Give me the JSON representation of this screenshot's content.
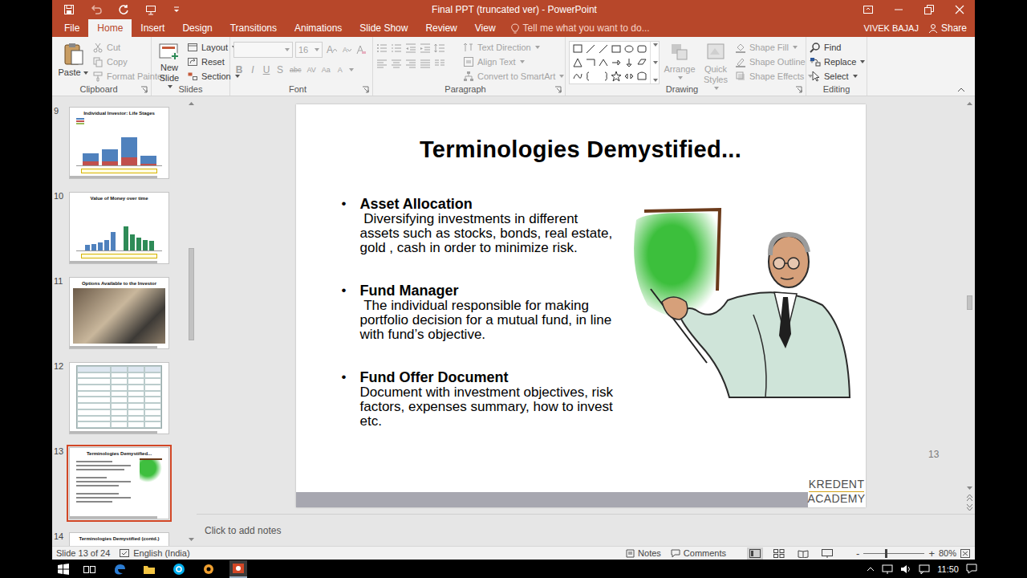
{
  "window": {
    "title": "Final PPT (truncated ver) - PowerPoint"
  },
  "tabs": [
    {
      "label": "File",
      "selected": false
    },
    {
      "label": "Home",
      "selected": true
    },
    {
      "label": "Insert",
      "selected": false
    },
    {
      "label": "Design",
      "selected": false
    },
    {
      "label": "Transitions",
      "selected": false
    },
    {
      "label": "Animations",
      "selected": false
    },
    {
      "label": "Slide Show",
      "selected": false
    },
    {
      "label": "Review",
      "selected": false
    },
    {
      "label": "View",
      "selected": false
    }
  ],
  "tell_me": "Tell me what you want to do...",
  "account": {
    "user": "VIVEK BAJAJ",
    "share": "Share"
  },
  "ribbon": {
    "clipboard": {
      "label": "Clipboard",
      "paste": "Paste",
      "items": [
        {
          "label": "Cut",
          "disabled": true
        },
        {
          "label": "Copy",
          "disabled": true
        },
        {
          "label": "Format Painter",
          "disabled": true
        }
      ]
    },
    "slides": {
      "label": "Slides",
      "new_slide": "New Slide",
      "items": [
        {
          "label": "Layout",
          "dropdown": true
        },
        {
          "label": "Reset",
          "dropdown": false
        },
        {
          "label": "Section",
          "dropdown": true
        }
      ]
    },
    "font": {
      "label": "Font",
      "size": "16",
      "disabled": true,
      "size_buttons": [
        "A",
        "A"
      ],
      "buttons": [
        "B",
        "I",
        "U",
        "S",
        "abc",
        "AV",
        "Aa",
        "A"
      ]
    },
    "paragraph": {
      "label": "Paragraph",
      "items": [
        {
          "label": "Text Direction",
          "disabled": true
        },
        {
          "label": "Align Text",
          "disabled": true
        },
        {
          "label": "Convert to SmartArt",
          "disabled": true
        }
      ]
    },
    "drawing": {
      "label": "Drawing",
      "arrange": "Arrange",
      "quick_styles": "Quick Styles",
      "items": [
        {
          "label": "Shape Fill",
          "disabled": true
        },
        {
          "label": "Shape Outline",
          "disabled": true
        },
        {
          "label": "Shape Effects",
          "disabled": true
        }
      ]
    },
    "editing": {
      "label": "Editing",
      "items": [
        {
          "label": "Find",
          "dropdown": false
        },
        {
          "label": "Replace",
          "dropdown": true
        },
        {
          "label": "Select",
          "dropdown": true
        }
      ]
    }
  },
  "thumbnails": [
    {
      "number": "9",
      "title": "Individual Investor: Life Stages",
      "kind": "stacked",
      "selected": false,
      "series": [
        [
          2,
          3,
          5,
          2
        ],
        [
          1,
          1,
          2,
          0.5
        ]
      ]
    },
    {
      "number": "10",
      "title": "Value of Money over time",
      "kind": "grouped",
      "selected": false,
      "series": [
        [
          2,
          2.5,
          3,
          4,
          7
        ],
        [
          9,
          6,
          5,
          4,
          3.5
        ]
      ]
    },
    {
      "number": "11",
      "title": "Options Available to the Investor",
      "kind": "photo",
      "selected": false
    },
    {
      "number": "12",
      "kind": "table",
      "selected": false
    },
    {
      "number": "13",
      "title": "Terminologies Demystified...",
      "kind": "terms",
      "selected": true
    },
    {
      "number": "14",
      "title": "Terminologies Demystified (contd.)",
      "kind": "text",
      "selected": false
    }
  ],
  "thumbnail_scroll": {
    "level": 0.42
  },
  "slide": {
    "title": "Terminologies Demystified...",
    "bullet": "•",
    "bullets": [
      {
        "term": "Asset Allocation",
        "text": " Diversifying investments in different assets such as stocks, bonds, real estate, gold , cash in order to minimize risk."
      },
      {
        "term": "Fund Manager",
        "text": " The individual responsible for making portfolio decision for a mutual fund, in line with fund’s objective."
      },
      {
        "term": "Fund Offer Document",
        "text": "Document with investment objectives, risk factors, expenses summary, how to invest  etc."
      }
    ],
    "page": "13",
    "logo": {
      "top": "KREDENT",
      "bottom": "ACADEMY"
    }
  },
  "slide_scroll": {
    "level": 0.52
  },
  "notes": {
    "placeholder": "Click to add notes"
  },
  "status_bar": {
    "slide": "Slide 13 of 24",
    "language": "English (India)",
    "notes": "Notes",
    "comments": "Comments",
    "views": [
      {
        "kind": "normal",
        "selected": true
      },
      {
        "kind": "sorter",
        "selected": false
      },
      {
        "kind": "reading",
        "selected": false
      },
      {
        "kind": "show",
        "selected": false
      }
    ],
    "zoom_out": "-",
    "zoom_in": "+",
    "zoom": {
      "level": 0.36
    },
    "zoom_reading": "80%"
  },
  "taskbar": {
    "time": "11:50"
  }
}
